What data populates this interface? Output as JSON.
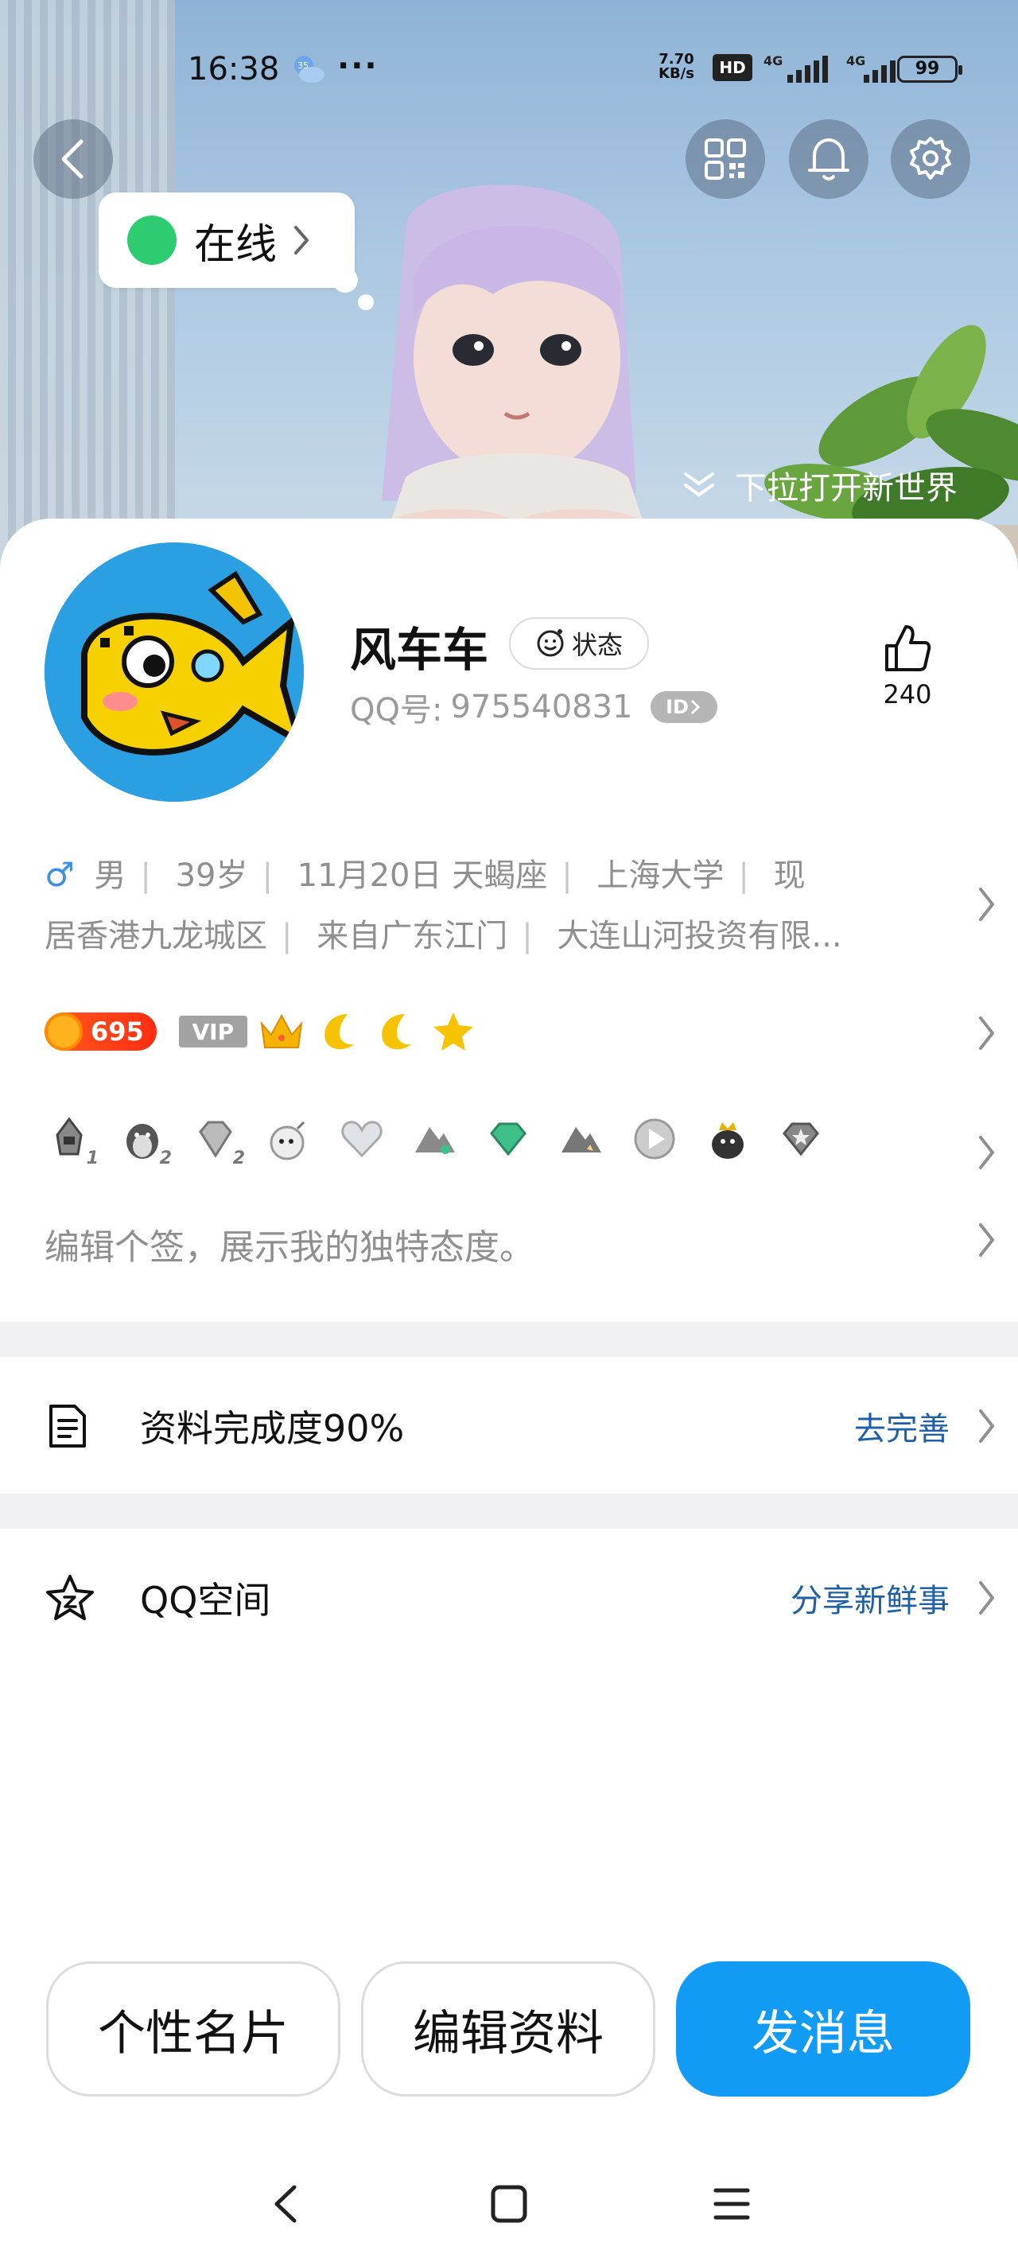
{
  "status_bar": {
    "time": "16:38",
    "weather_badge": "35",
    "more_dots": "···",
    "net_speed_value": "7.70",
    "net_speed_unit": "KB/s",
    "hd_label": "HD",
    "network_1": "4G",
    "network_2": "4G",
    "battery": "99"
  },
  "header": {
    "online_status": "在线",
    "pull_hint": "下拉打开新世界"
  },
  "profile": {
    "name": "风车车",
    "status_button": "状态",
    "qq_label": "QQ号:",
    "qq_number": "975540831",
    "id_badge": "ID",
    "like_count": "240",
    "gender_symbol": "♂",
    "info_line1": [
      "男",
      "39岁",
      "11月20日  天蝎座",
      "上海大学",
      "现"
    ],
    "info_line2": [
      "居香港九龙城区",
      "来自广东江门",
      "大连山河投资有限..."
    ],
    "coin_level": "695",
    "vip_label": "VIP",
    "signature_placeholder": "编辑个签，展示我的独特态度。"
  },
  "badges": [
    {
      "icon": "rocket-badge-icon",
      "level": "1"
    },
    {
      "icon": "penguin-badge-icon",
      "level": "2"
    },
    {
      "icon": "diamond-badge-icon",
      "level": "2"
    },
    {
      "icon": "bomb-badge-icon",
      "level": ""
    },
    {
      "icon": "heart-badge-icon",
      "level": ""
    },
    {
      "icon": "mountain-badge-icon",
      "level": ""
    },
    {
      "icon": "gem-badge-icon",
      "level": ""
    },
    {
      "icon": "mountain-star-badge-icon",
      "level": ""
    },
    {
      "icon": "play-badge-icon",
      "level": ""
    },
    {
      "icon": "penguin-crown-badge-icon",
      "level": ""
    },
    {
      "icon": "diamond-star-badge-icon",
      "level": ""
    }
  ],
  "sections": {
    "completion_title": "资料完成度90%",
    "completion_action": "去完善",
    "qzone_title": "QQ空间",
    "qzone_action": "分享新鲜事"
  },
  "actions": {
    "card": "个性名片",
    "edit": "编辑资料",
    "message": "发消息"
  },
  "colors": {
    "accent": "#129bf5",
    "link": "#1f5fa8",
    "online": "#2ecc71",
    "avatar_bg": "#2aa0e3"
  }
}
